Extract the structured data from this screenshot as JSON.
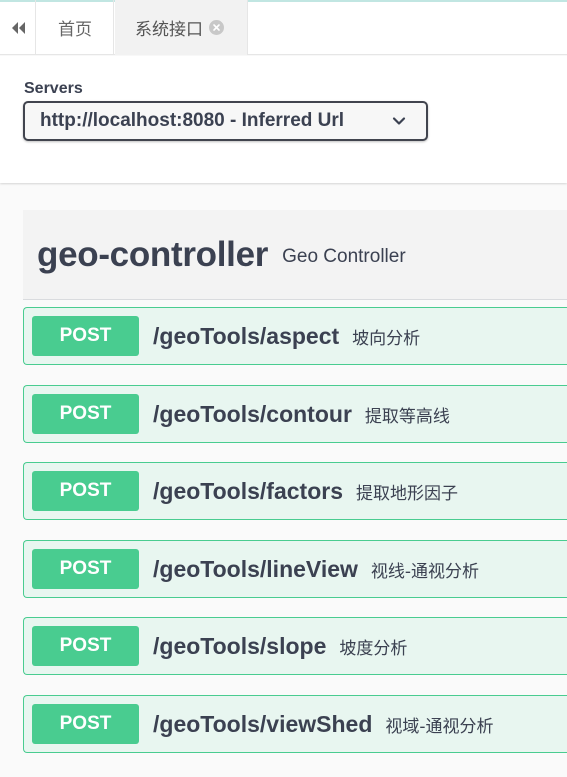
{
  "tabs": [
    {
      "label": "首页"
    },
    {
      "label": "系统接口"
    }
  ],
  "servers": {
    "label": "Servers",
    "selected": "http://localhost:8080 - Inferred Url"
  },
  "tag": {
    "name": "geo-controller",
    "description": "Geo Controller"
  },
  "operations": [
    {
      "method": "POST",
      "path": "/geoTools/aspect",
      "summary": "坡向分析"
    },
    {
      "method": "POST",
      "path": "/geoTools/contour",
      "summary": "提取等高线"
    },
    {
      "method": "POST",
      "path": "/geoTools/factors",
      "summary": "提取地形因子"
    },
    {
      "method": "POST",
      "path": "/geoTools/lineView",
      "summary": "视线-通视分析"
    },
    {
      "method": "POST",
      "path": "/geoTools/slope",
      "summary": "坡度分析"
    },
    {
      "method": "POST",
      "path": "/geoTools/viewShed",
      "summary": "视域-通视分析"
    }
  ],
  "colors": {
    "post_accent": "#49cc90",
    "post_background": "#e8f6f0",
    "text": "#3b4151"
  },
  "icons": {
    "collapse": "double-chevron-left-icon",
    "tab_close": "close-circle-icon",
    "select": "chevron-down-icon"
  }
}
